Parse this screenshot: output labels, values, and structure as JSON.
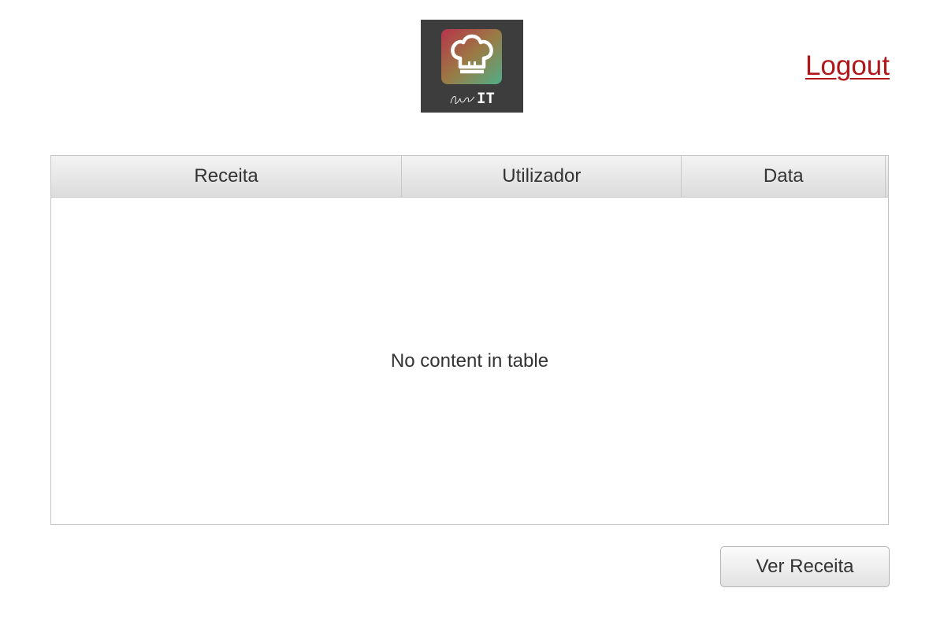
{
  "header": {
    "logo_text": "ChefIT",
    "logout_label": "Logout"
  },
  "table": {
    "columns": [
      "Receita",
      "Utilizador",
      "Data"
    ],
    "rows": [],
    "placeholder": "No content in table"
  },
  "actions": {
    "view_recipe_label": "Ver Receita"
  },
  "colors": {
    "logout_link": "#b0171b",
    "logo_background": "#3d3d3d",
    "logo_gradient_start": "#b8334a",
    "logo_gradient_end": "#5da87a"
  }
}
